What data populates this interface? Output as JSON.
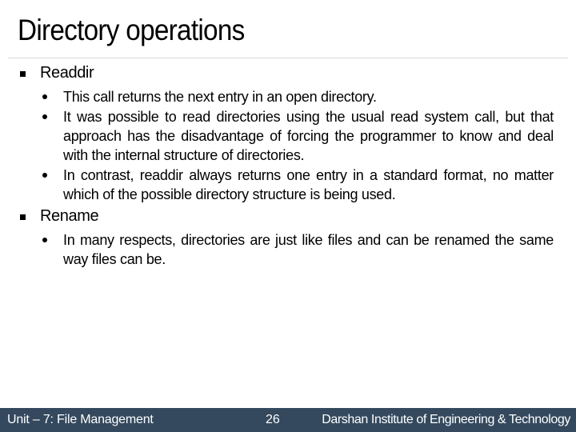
{
  "slide": {
    "title": "Directory operations",
    "sections": [
      {
        "heading": "Readdir",
        "bullets": [
          "This call returns the next entry in an open directory.",
          "It was possible to read directories using the usual read system call, but that approach has the disadvantage of forcing the programmer to know and deal with the internal structure of directories.",
          "In contrast, readdir always returns one entry in a standard format, no matter which of the possible directory structure is being used."
        ]
      },
      {
        "heading": "Rename",
        "bullets": [
          "In many respects, directories are just like files and can be renamed the same way files can be."
        ]
      }
    ]
  },
  "footer": {
    "unit": "Unit – 7: File Management",
    "page_number": "26",
    "institute": "Darshan Institute of Engineering & Technology",
    "background_color": "#34495e"
  },
  "icons": {
    "level1_bullet": "square-bullet-icon",
    "level2_bullet": "round-bullet-icon"
  }
}
